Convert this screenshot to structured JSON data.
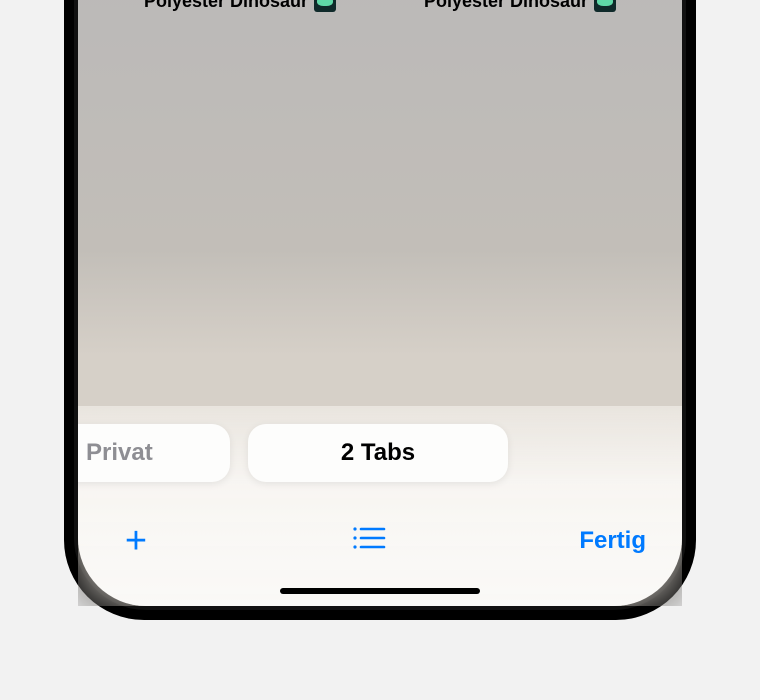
{
  "tabs": [
    {
      "title": "Polyester Dinosaur",
      "favicon": "dinosaur-icon"
    },
    {
      "title": "Polyester Dinosaur",
      "favicon": "dinosaur-icon"
    }
  ],
  "pills": {
    "private_label": "Privat",
    "tabs_label": "2 Tabs"
  },
  "toolbar": {
    "add_label": "+",
    "done_label": "Fertig"
  },
  "colors": {
    "accent": "#007aff"
  }
}
